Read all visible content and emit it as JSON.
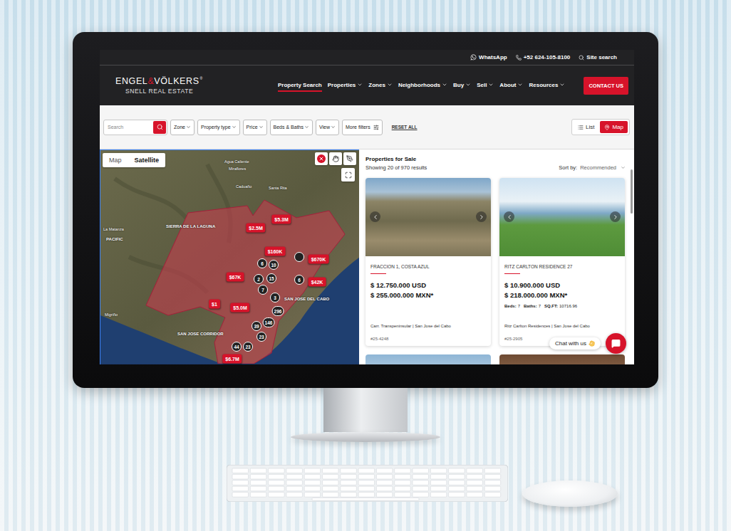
{
  "top_bar": {
    "whatsapp": "WhatsApp",
    "phone": "+52 624-105-8100",
    "site_search": "Site search"
  },
  "logo": {
    "brand_left": "ENGEL",
    "brand_amp": "&",
    "brand_right": "VÖLKERS",
    "mark": "®",
    "subtitle": "SNELL REAL ESTATE"
  },
  "nav": [
    {
      "label": "Property Search",
      "selected": true,
      "kind": "link"
    },
    {
      "label": "Properties",
      "selected": false,
      "kind": "menu"
    },
    {
      "label": "Zones",
      "selected": false,
      "kind": "menu"
    },
    {
      "label": "Neighborhoods",
      "selected": false,
      "kind": "menu"
    },
    {
      "label": "Buy",
      "selected": false,
      "kind": "menu"
    },
    {
      "label": "Sell",
      "selected": false,
      "kind": "menu"
    },
    {
      "label": "About",
      "selected": false,
      "kind": "menu"
    },
    {
      "label": "Resources",
      "selected": false,
      "kind": "menu"
    }
  ],
  "contact_button": "CONTACT US",
  "filters": {
    "search_placeholder": "Search",
    "chips": [
      "Zone",
      "Property type",
      "Price",
      "Beds & Baths",
      "View"
    ],
    "more_filters": "More filters",
    "reset": "RESET ALL",
    "views": [
      {
        "label": "List",
        "selected": false
      },
      {
        "label": "Map",
        "selected": true
      }
    ]
  },
  "map": {
    "types": [
      {
        "label": "Map",
        "selected": false
      },
      {
        "label": "Satellite",
        "selected": true
      }
    ],
    "labels": [
      {
        "text": "Agua Caliente",
        "kind": "town"
      },
      {
        "text": "Miraflores",
        "kind": "town"
      },
      {
        "text": "Caduaño",
        "kind": "town"
      },
      {
        "text": "Santa Rita",
        "kind": "town"
      },
      {
        "text": "SIERRA DE LA LAGUNA",
        "kind": "area"
      },
      {
        "text": "La Matanza",
        "kind": "town"
      },
      {
        "text": "PACIFIC",
        "kind": "area"
      },
      {
        "text": "Migriño",
        "kind": "town"
      },
      {
        "text": "SAN JOSE DEL CABO",
        "kind": "area"
      },
      {
        "text": "SAN JOSE CORRIDOR",
        "kind": "area"
      }
    ],
    "pins": [
      {
        "label": "$5.3M",
        "kind": "price"
      },
      {
        "label": "$2.5M",
        "kind": "price"
      },
      {
        "label": "$160K",
        "kind": "price"
      },
      {
        "label": "",
        "kind": "marker"
      },
      {
        "label": "$670K",
        "kind": "price"
      },
      {
        "label": "6",
        "kind": "cluster"
      },
      {
        "label": "10",
        "kind": "cluster"
      },
      {
        "label": "$67K",
        "kind": "price"
      },
      {
        "label": "2",
        "kind": "cluster"
      },
      {
        "label": "15",
        "kind": "cluster"
      },
      {
        "label": "6",
        "kind": "cluster"
      },
      {
        "label": "$42K",
        "kind": "price"
      },
      {
        "label": "7",
        "kind": "cluster"
      },
      {
        "label": "3",
        "kind": "cluster"
      },
      {
        "label": "$1",
        "kind": "price"
      },
      {
        "label": "$5.0M",
        "kind": "price"
      },
      {
        "label": "296",
        "kind": "cluster"
      },
      {
        "label": "146",
        "kind": "cluster"
      },
      {
        "label": "39",
        "kind": "cluster"
      },
      {
        "label": "23",
        "kind": "cluster"
      },
      {
        "label": "44",
        "kind": "cluster"
      },
      {
        "label": "23",
        "kind": "cluster"
      },
      {
        "label": "$6.7M",
        "kind": "price"
      }
    ]
  },
  "results": {
    "title": "Properties for Sale",
    "count": "Showing 20 of 970 results",
    "sort_label": "Sort by:",
    "sort_value": "Recommended",
    "cards": [
      {
        "title": "FRACCION 1, COSTA AZUL",
        "price_usd": "$ 12.750.000 USD",
        "price_mxn": "$ 255.000.000 MXN*",
        "specs": [],
        "location": "Carr. Transpeninsular | San Jose del Cabo",
        "id": "#25-4248"
      },
      {
        "title": "RITZ CARLTON RESIDENCE 27",
        "price_usd": "$ 10.900.000 USD",
        "price_mxn": "$ 218.000.000 MXN*",
        "specs": [
          {
            "label": "Beds:",
            "value": "7"
          },
          {
            "label": "Baths:",
            "value": "7"
          },
          {
            "label": "SQ.FT:",
            "value": "10716.96"
          }
        ],
        "location": "Ritz Carlton Residences | San Jose del Cabo",
        "id": "#25-2905"
      }
    ]
  },
  "chat": {
    "label": "Chat with us"
  }
}
